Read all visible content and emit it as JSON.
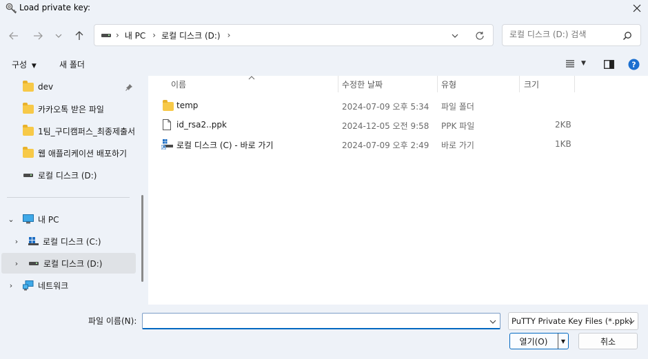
{
  "window": {
    "title": "Load private key:"
  },
  "address": {
    "segments": [
      "내 PC",
      "로컬 디스크 (D:)"
    ]
  },
  "search": {
    "placeholder": "로컬 디스크 (D:) 검색"
  },
  "commandbar": {
    "organize": "구성",
    "new_folder": "새 폴더"
  },
  "sidebar": {
    "pinned": [
      {
        "label": "dev",
        "icon": "folder-icon",
        "pinned": true
      },
      {
        "label": "카카오톡 받은 파일",
        "icon": "folder-icon"
      },
      {
        "label": "1팀_구디캠퍼스_최종제출서",
        "icon": "folder-icon"
      },
      {
        "label": "웹 애플리케이션 배포하기",
        "icon": "folder-icon"
      },
      {
        "label": "로컬 디스크 (D:)",
        "icon": "drive-icon"
      }
    ],
    "tree": [
      {
        "label": "내 PC",
        "icon": "pc-icon",
        "expanded": true
      },
      {
        "label": "로컬 디스크 (C:)",
        "icon": "windows-drive-icon"
      },
      {
        "label": "로컬 디스크 (D:)",
        "icon": "drive-icon",
        "selected": true
      },
      {
        "label": "네트워크",
        "icon": "network-icon"
      }
    ]
  },
  "columns": {
    "name": "이름",
    "modified": "수정한 날짜",
    "type": "유형",
    "size": "크기"
  },
  "files": [
    {
      "name": "temp",
      "modified": "2024-07-09 오후 5:34",
      "type": "파일 폴더",
      "size": "",
      "icon": "folder-icon"
    },
    {
      "name": "id_rsa2..ppk",
      "modified": "2024-12-05 오전 9:58",
      "type": "PPK 파일",
      "size": "2KB",
      "icon": "file-icon"
    },
    {
      "name": "로컬 디스크 (C) - 바로 가기",
      "modified": "2024-07-09 오후 2:49",
      "type": "바로 가기",
      "size": "1KB",
      "icon": "shortcut-icon"
    }
  ],
  "footer": {
    "filename_label": "파일 이름(N):",
    "filename_value": "",
    "filetype": "PuTTY Private Key Files (*.ppk)",
    "open": "열기(O)",
    "cancel": "취소"
  },
  "colors": {
    "accent": "#0067c0",
    "folder": "#f7c948",
    "selected": "#dfe2e6"
  }
}
